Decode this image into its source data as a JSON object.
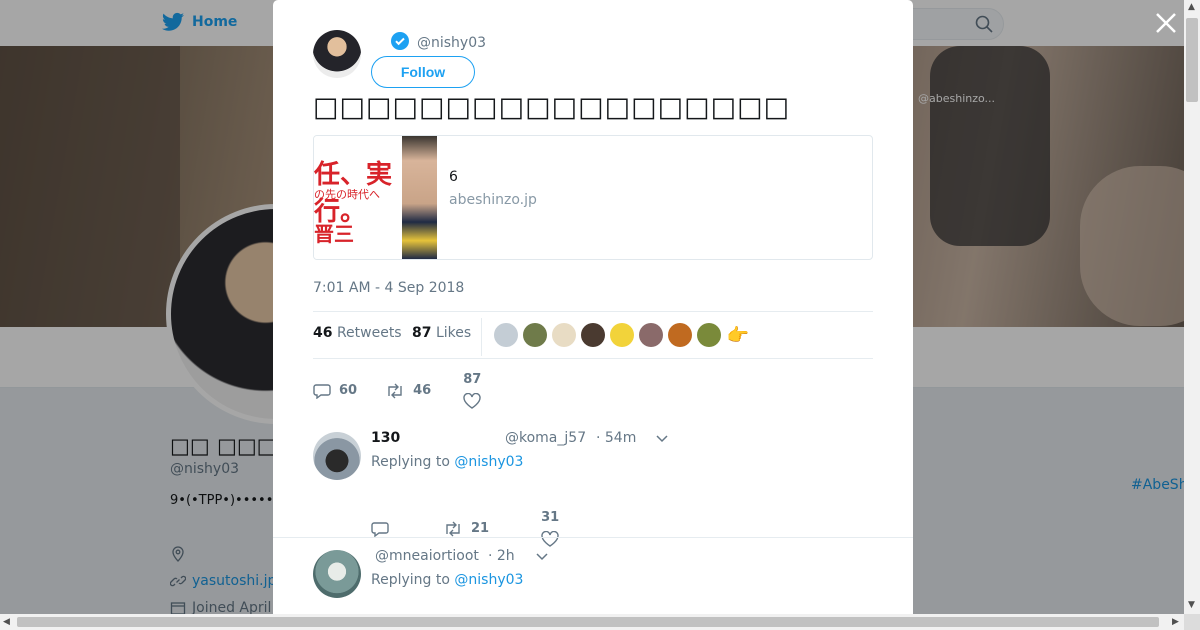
{
  "background": {
    "nav_home": "Home",
    "profile_name": "□□ □□□□",
    "profile_handle": "@nishy03",
    "bio": "9•(•TPP•)••••••",
    "url": "yasutoshi.jp",
    "joined": "Joined April",
    "hashtag": "#AbeSh",
    "banner_small_text": "@abeshinzo..."
  },
  "modal": {
    "handle": "@nishy03",
    "follow_label": "Follow",
    "tweet_text": "□□□□□□□□□□□□□□□□□□",
    "card": {
      "title": "6",
      "domain": "abeshinzo.jp",
      "img_line1": "任、実行。",
      "img_line2": "の先の時代へ",
      "img_line3": "晋三"
    },
    "timestamp": "7:01 AM - 4 Sep 2018",
    "retweets_count": "46",
    "retweets_label": "Retweets",
    "likes_count": "87",
    "likes_label": "Likes",
    "actions": {
      "replies": "60",
      "retweets": "46",
      "likes": "87"
    }
  },
  "replies": [
    {
      "name": "130",
      "handle": "@koma_j57",
      "time": "· 54m",
      "replying_prefix": "Replying to",
      "replying_to": "@nishy03",
      "replies": "",
      "retweets": "21",
      "likes": "31"
    },
    {
      "name": "",
      "handle": "@mneaiortioot",
      "time": "· 2h",
      "replying_prefix": "Replying to",
      "replying_to": "@nishy03"
    }
  ],
  "colors": {
    "accent": "#1da1f2",
    "link": "#1b95e0",
    "muted": "#657786"
  }
}
